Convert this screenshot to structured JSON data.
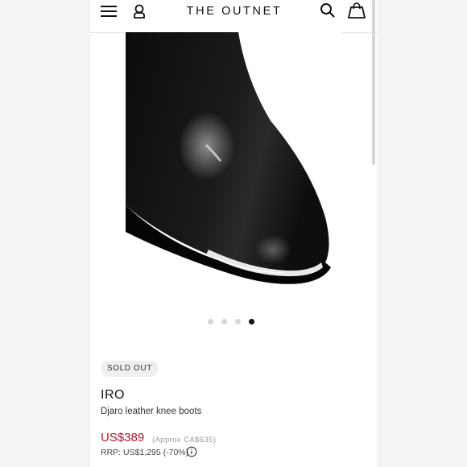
{
  "header": {
    "logo_text": "THE OUTNET",
    "icons": [
      "menu-icon",
      "account-icon",
      "search-icon",
      "bag-icon"
    ]
  },
  "gallery": {
    "image_description_icon": "product-photo",
    "slide_count": 4,
    "active_slide": 4
  },
  "product": {
    "badge": "SOLD OUT",
    "brand": "IRO",
    "name": "Djaro leather knee boots",
    "price": "US$389",
    "approx_price": "(Approx CA$535)",
    "rrp": "RRP: US$1,295 (-70%)"
  },
  "colors": {
    "sale_price": "#b0182a",
    "active_dot": "#111111",
    "inactive_dot": "#d6d6d6"
  }
}
